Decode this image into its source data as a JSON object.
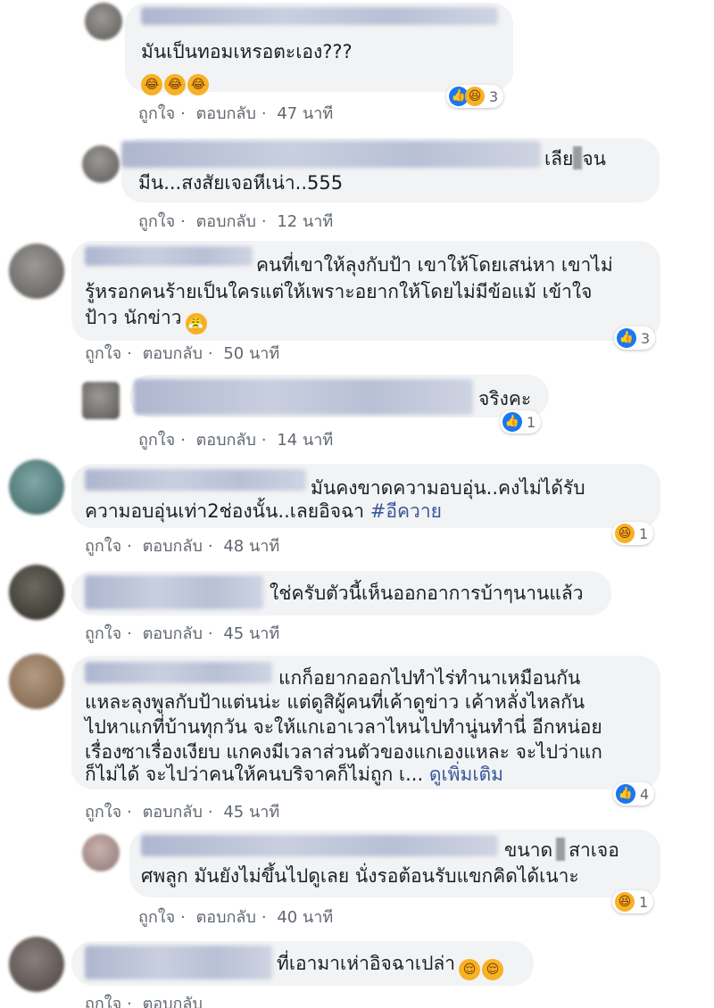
{
  "labels": {
    "like": "ถูกใจ",
    "reply": "ตอบกลับ",
    "sep": "·",
    "see_more": "ดูเพิ่มเติม"
  },
  "colors": {
    "like": "#1877f2",
    "haha": "#f7b125",
    "bubble": "#f2f3f5",
    "link": "#385898"
  },
  "comments": [
    {
      "id": "c1",
      "lines": [
        "มันเป็นทอมเหรอตะเอง???"
      ],
      "emojis": [
        "laughing-emoji",
        "laughing-emoji",
        "laughing-emoji"
      ],
      "time": "47 นาที",
      "reactions": [
        "like",
        "haha"
      ],
      "count": "3"
    },
    {
      "id": "c2",
      "lines": [
        "เลีย",
        "จน",
        "มีน...สงสัยเจอหีเน่า..555"
      ],
      "time": "12 นาที"
    },
    {
      "id": "c3",
      "lines": [
        "คนที่เขาให้ลุงกับป้า เขาให้โดยเสน่หา เขาไม่",
        "รู้หรอกคนร้ายเป็นใครแต่ให้เพราะอยากให้โดยไม่มีข้อแม้ เข้าใจ",
        "ป้าว นักข่าว"
      ],
      "time": "50 นาที",
      "reactions": [
        "like"
      ],
      "count": "3"
    },
    {
      "id": "c4",
      "lines": [
        "จริงคะ"
      ],
      "time": "14 นาที",
      "reactions": [
        "like"
      ],
      "count": "1"
    },
    {
      "id": "c5",
      "lines": [
        "มันคงขาดความอบอุ่น..คงไม่ได้รับ",
        "ความอบอุ่นเท่า2ช่องนั้น..เลยอิจฉา "
      ],
      "hashtag": "#อีควาย",
      "time": "48 นาที",
      "reactions": [
        "haha"
      ],
      "count": "1"
    },
    {
      "id": "c6",
      "lines": [
        "ใช่ครับตัวนี้เห็นออกอาการบ้าๆนานแล้ว"
      ],
      "time": "45 นาที"
    },
    {
      "id": "c7",
      "lines": [
        "แกก็อยากออกไปทำไร่ทำนาเหมือนกัน",
        "แหละลุงพูลกับป้าแต่นน่ะ แต่ดูสิผู้คนที่เค้าดูข่าว เค้าหลั่งไหลกัน",
        "ไปหาแกที่บ้านทุกวัน จะให้แกเอาเวลาไหนไปทำนู่นทำนี่ อีกหน่อย",
        "เรื่องซาเรื่องเงียบ แกคงมีเวลาส่วนตัวของแกเองแหละ จะไปว่าแก",
        "ก็ไม่ได้ จะไปว่าคนให้คนบริจาคก็ไม่ถูก เ... "
      ],
      "time": "45 นาที",
      "reactions": [
        "like"
      ],
      "count": "4"
    },
    {
      "id": "c8",
      "lines": [
        "ขนาด",
        "สาเจอ",
        "ศพลูก มันยังไม่ขึ้นไปดูเลย นั่งรอต้อนรับแขกคิดได้เนาะ"
      ],
      "time": "40 นาที",
      "reactions": [
        "haha"
      ],
      "count": "1"
    },
    {
      "id": "c9",
      "lines": [
        "ที่เอามาเห่าอิจฉาเปล่า"
      ],
      "emojis": [
        "relieved-emoji",
        "relieved-emoji"
      ],
      "time": ""
    }
  ]
}
